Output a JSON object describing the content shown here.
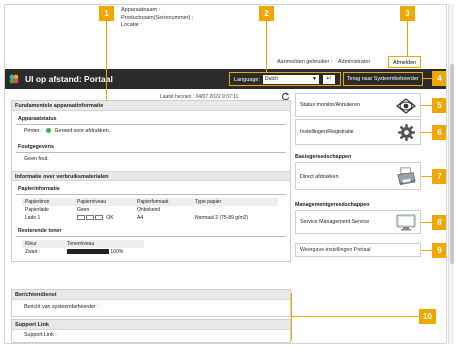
{
  "top": {
    "device_name_label": "Apparaatnaam :",
    "product_name_label": "Productnaam(Serienummer) :",
    "location_label": "Locatie :",
    "login_label": "Aanmelden gebruiker :",
    "login_user": "Administrator",
    "logout_label": "Afmelden"
  },
  "header": {
    "title": "UI op afstand: Portaal",
    "language_label": "Language:",
    "language_value": "Dutch",
    "portal_button": "Terug naar Systeembeheerder"
  },
  "updated": "Laatst herzien : 04/07 2022 9:37:11",
  "device_info": {
    "title": "Fundamentele apparaatinformatie",
    "status_head": "Apparaatstatus",
    "printer_label": "Printer :",
    "printer_status": "Gereed voor afdrukken.",
    "error_head": "Foutgegevens",
    "error_text": "Geen fout."
  },
  "consumables": {
    "title": "Informatie over verbruiksmaterialen",
    "paper_head": "Papierinformatie",
    "paper_columns": [
      "Papierbron",
      "Papierniveau",
      "Papierformaat",
      "Type papier"
    ],
    "paper_rows": [
      [
        "Papierlade",
        "Geen",
        "Onbekend",
        ""
      ],
      [
        "Lade 1",
        "OK",
        "A4",
        "Normaal 2 (75-89 g/m2)"
      ]
    ],
    "toner_head": "Resterende toner",
    "toner_columns": [
      "Kleur",
      "Tonerniveau"
    ],
    "toner_rows": [
      [
        "Zwart :",
        "100%"
      ]
    ]
  },
  "message": {
    "title": "Berichtendienst",
    "text": "Bericht van systeembeheerder :"
  },
  "support": {
    "title": "Support Link",
    "text": "Support Link :"
  },
  "menu": {
    "status_monitor": "Status monitor/Annuleren",
    "settings": "Instellingen/Registratie",
    "basic_tools": "Basisgereedschappen",
    "direct_print": "Direct afdrukken",
    "mgmt_tools": "Managementgereedschappen",
    "service_mgmt": "Service Management Service",
    "portal_display": "Weergave-instellingen Portaal"
  },
  "callouts": [
    "1",
    "2",
    "3",
    "4",
    "5",
    "6",
    "7",
    "8",
    "9",
    "10"
  ],
  "colors": {
    "accent": "#f0a800",
    "header_bg": "#2b2b2b",
    "ok_green": "#3cb043"
  }
}
